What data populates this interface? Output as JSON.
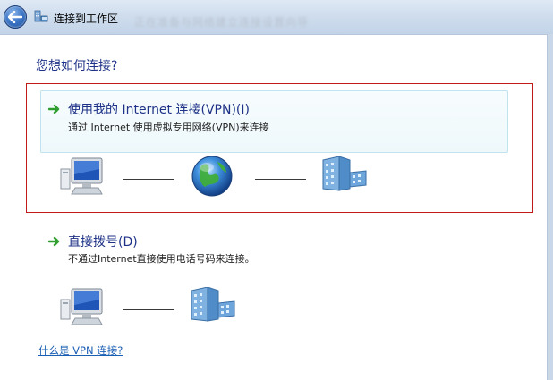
{
  "window": {
    "title": "连接到工作区",
    "blurred_caption": "正在准备与网络建立连接设置向导"
  },
  "main": {
    "question": "您想如何连接?"
  },
  "options": [
    {
      "title": "使用我的 Internet 连接(VPN)(I)",
      "description": "通过 Internet 使用虚拟专用网络(VPN)来连接",
      "diagram_icons": [
        "computer-icon",
        "globe-icon",
        "workplace-icon"
      ]
    },
    {
      "title": "直接拨号(D)",
      "description": "不通过Internet直接使用电话号码来连接。",
      "diagram_icons": [
        "computer-icon",
        "workplace-icon"
      ]
    }
  ],
  "help": {
    "link": "什么是 VPN 连接?"
  },
  "colors": {
    "accent_text": "#1e3287",
    "highlight_border": "#c21a1a",
    "link": "#1a5fb4"
  },
  "icons": {
    "back": "back-arrow-icon",
    "title": "workplace-network-icon",
    "option_arrow": "green-arrow-icon"
  }
}
